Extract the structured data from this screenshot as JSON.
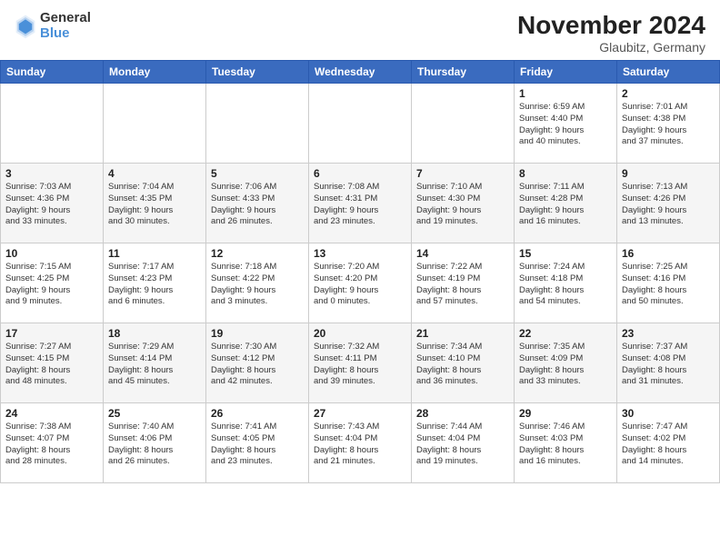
{
  "header": {
    "logo_general": "General",
    "logo_blue": "Blue",
    "month_title": "November 2024",
    "location": "Glaubitz, Germany"
  },
  "weekdays": [
    "Sunday",
    "Monday",
    "Tuesday",
    "Wednesday",
    "Thursday",
    "Friday",
    "Saturday"
  ],
  "weeks": [
    [
      {
        "day": "",
        "info": ""
      },
      {
        "day": "",
        "info": ""
      },
      {
        "day": "",
        "info": ""
      },
      {
        "day": "",
        "info": ""
      },
      {
        "day": "",
        "info": ""
      },
      {
        "day": "1",
        "info": "Sunrise: 6:59 AM\nSunset: 4:40 PM\nDaylight: 9 hours\nand 40 minutes."
      },
      {
        "day": "2",
        "info": "Sunrise: 7:01 AM\nSunset: 4:38 PM\nDaylight: 9 hours\nand 37 minutes."
      }
    ],
    [
      {
        "day": "3",
        "info": "Sunrise: 7:03 AM\nSunset: 4:36 PM\nDaylight: 9 hours\nand 33 minutes."
      },
      {
        "day": "4",
        "info": "Sunrise: 7:04 AM\nSunset: 4:35 PM\nDaylight: 9 hours\nand 30 minutes."
      },
      {
        "day": "5",
        "info": "Sunrise: 7:06 AM\nSunset: 4:33 PM\nDaylight: 9 hours\nand 26 minutes."
      },
      {
        "day": "6",
        "info": "Sunrise: 7:08 AM\nSunset: 4:31 PM\nDaylight: 9 hours\nand 23 minutes."
      },
      {
        "day": "7",
        "info": "Sunrise: 7:10 AM\nSunset: 4:30 PM\nDaylight: 9 hours\nand 19 minutes."
      },
      {
        "day": "8",
        "info": "Sunrise: 7:11 AM\nSunset: 4:28 PM\nDaylight: 9 hours\nand 16 minutes."
      },
      {
        "day": "9",
        "info": "Sunrise: 7:13 AM\nSunset: 4:26 PM\nDaylight: 9 hours\nand 13 minutes."
      }
    ],
    [
      {
        "day": "10",
        "info": "Sunrise: 7:15 AM\nSunset: 4:25 PM\nDaylight: 9 hours\nand 9 minutes."
      },
      {
        "day": "11",
        "info": "Sunrise: 7:17 AM\nSunset: 4:23 PM\nDaylight: 9 hours\nand 6 minutes."
      },
      {
        "day": "12",
        "info": "Sunrise: 7:18 AM\nSunset: 4:22 PM\nDaylight: 9 hours\nand 3 minutes."
      },
      {
        "day": "13",
        "info": "Sunrise: 7:20 AM\nSunset: 4:20 PM\nDaylight: 9 hours\nand 0 minutes."
      },
      {
        "day": "14",
        "info": "Sunrise: 7:22 AM\nSunset: 4:19 PM\nDaylight: 8 hours\nand 57 minutes."
      },
      {
        "day": "15",
        "info": "Sunrise: 7:24 AM\nSunset: 4:18 PM\nDaylight: 8 hours\nand 54 minutes."
      },
      {
        "day": "16",
        "info": "Sunrise: 7:25 AM\nSunset: 4:16 PM\nDaylight: 8 hours\nand 50 minutes."
      }
    ],
    [
      {
        "day": "17",
        "info": "Sunrise: 7:27 AM\nSunset: 4:15 PM\nDaylight: 8 hours\nand 48 minutes."
      },
      {
        "day": "18",
        "info": "Sunrise: 7:29 AM\nSunset: 4:14 PM\nDaylight: 8 hours\nand 45 minutes."
      },
      {
        "day": "19",
        "info": "Sunrise: 7:30 AM\nSunset: 4:12 PM\nDaylight: 8 hours\nand 42 minutes."
      },
      {
        "day": "20",
        "info": "Sunrise: 7:32 AM\nSunset: 4:11 PM\nDaylight: 8 hours\nand 39 minutes."
      },
      {
        "day": "21",
        "info": "Sunrise: 7:34 AM\nSunset: 4:10 PM\nDaylight: 8 hours\nand 36 minutes."
      },
      {
        "day": "22",
        "info": "Sunrise: 7:35 AM\nSunset: 4:09 PM\nDaylight: 8 hours\nand 33 minutes."
      },
      {
        "day": "23",
        "info": "Sunrise: 7:37 AM\nSunset: 4:08 PM\nDaylight: 8 hours\nand 31 minutes."
      }
    ],
    [
      {
        "day": "24",
        "info": "Sunrise: 7:38 AM\nSunset: 4:07 PM\nDaylight: 8 hours\nand 28 minutes."
      },
      {
        "day": "25",
        "info": "Sunrise: 7:40 AM\nSunset: 4:06 PM\nDaylight: 8 hours\nand 26 minutes."
      },
      {
        "day": "26",
        "info": "Sunrise: 7:41 AM\nSunset: 4:05 PM\nDaylight: 8 hours\nand 23 minutes."
      },
      {
        "day": "27",
        "info": "Sunrise: 7:43 AM\nSunset: 4:04 PM\nDaylight: 8 hours\nand 21 minutes."
      },
      {
        "day": "28",
        "info": "Sunrise: 7:44 AM\nSunset: 4:04 PM\nDaylight: 8 hours\nand 19 minutes."
      },
      {
        "day": "29",
        "info": "Sunrise: 7:46 AM\nSunset: 4:03 PM\nDaylight: 8 hours\nand 16 minutes."
      },
      {
        "day": "30",
        "info": "Sunrise: 7:47 AM\nSunset: 4:02 PM\nDaylight: 8 hours\nand 14 minutes."
      }
    ]
  ]
}
